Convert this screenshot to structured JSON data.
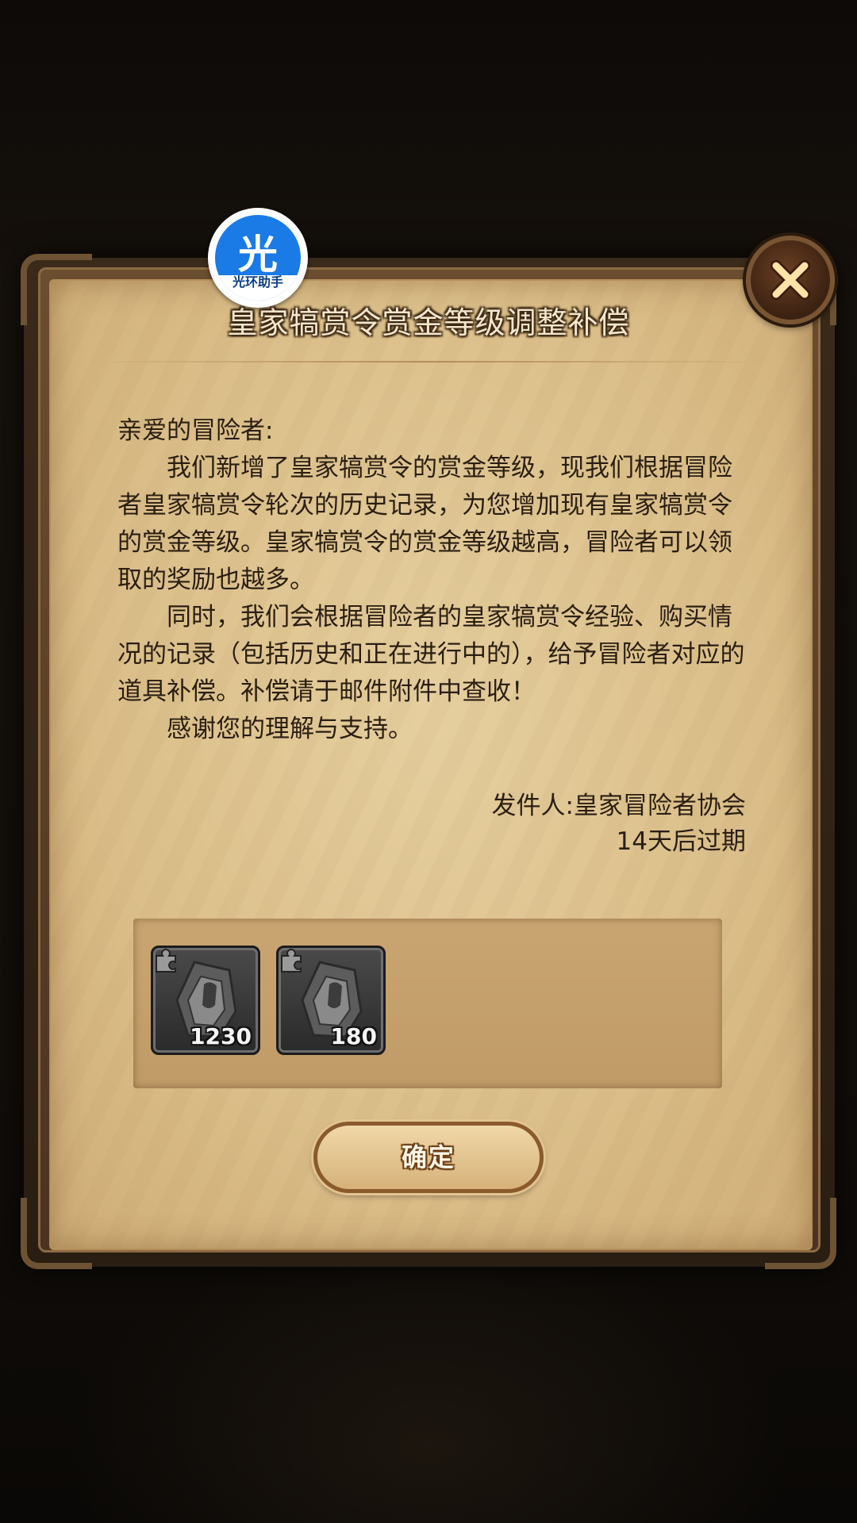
{
  "watermark": {
    "glyph": "光",
    "label": "光环助手"
  },
  "mail": {
    "title": "皇家犒赏令赏金等级调整补偿",
    "greeting": "亲爱的冒险者:",
    "paragraphs": [
      "我们新增了皇家犒赏令的赏金等级，现我们根据冒险者皇家犒赏令轮次的历史记录，为您增加现有皇家犒赏令的赏金等级。皇家犒赏令的赏金等级越高，冒险者可以领取的奖励也越多。",
      "同时，我们会根据冒险者的皇家犒赏令经验、购买情况的记录（包括历史和正在进行中的），给予冒险者对应的道具补偿。补偿请于邮件附件中查收！",
      "感谢您的理解与支持。"
    ],
    "sender": "发件人:皇家冒险者协会",
    "expiry": "14天后过期"
  },
  "attachments": [
    {
      "icon": "armor-fragment-icon",
      "count": "1230"
    },
    {
      "icon": "armor-fragment-icon",
      "count": "180"
    }
  ],
  "buttons": {
    "confirm": "确定",
    "close_icon": "close-x-icon"
  },
  "colors": {
    "parchment": "#dcc08b",
    "frame": "#4a3320",
    "text": "#2a1e12",
    "close_accent": "#ffb347",
    "watermark_blue": "#1a7ae6"
  }
}
